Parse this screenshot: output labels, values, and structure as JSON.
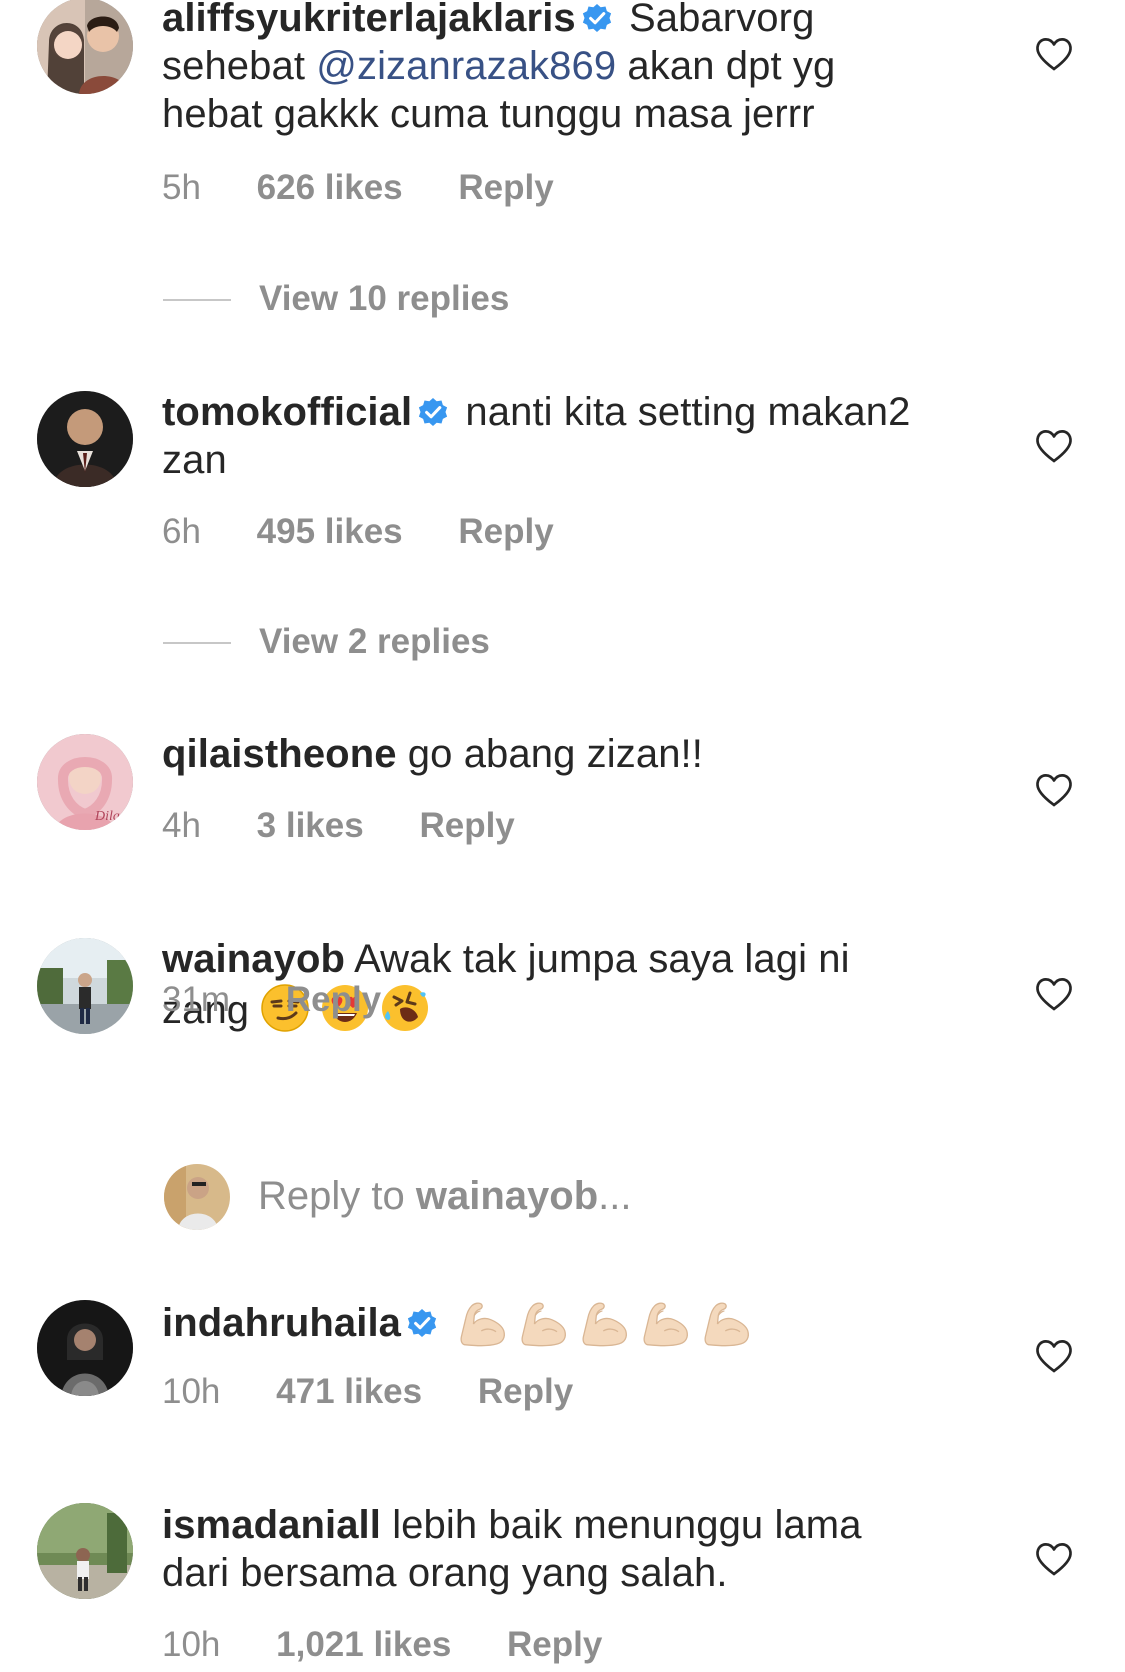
{
  "comments": [
    {
      "username": "aliffsyukriterlajaklaris",
      "verified": true,
      "text_before": " Sabarvorg sehebat ",
      "mention": "@zizanrazak869",
      "text_after": " akan dpt yg hebat gakkk cuma tunggu masa jerrr",
      "time": "5h",
      "likes": "626 likes",
      "reply_label": "Reply",
      "view_replies": "View 10 replies"
    },
    {
      "username": "tomokofficial",
      "verified": true,
      "text": " nanti kita setting makan2 zan",
      "time": "6h",
      "likes": "495 likes",
      "reply_label": "Reply",
      "view_replies": "View 2 replies"
    },
    {
      "username": "qilaistheone",
      "verified": false,
      "text": " go abang zizan!!",
      "time": "4h",
      "likes": "3 likes",
      "reply_label": "Reply"
    },
    {
      "username": "wainayob",
      "verified": false,
      "text": " Awak tak jumpa saya lagi ni zang",
      "emojis": [
        "smirking-face",
        "heart-eyes-face",
        "rolling-laughing-face"
      ],
      "time": "31m",
      "reply_label": "Reply"
    },
    {
      "username": "indahruhaila",
      "verified": true,
      "emojis": [
        "flexed-biceps",
        "flexed-biceps",
        "flexed-biceps",
        "flexed-biceps",
        "flexed-biceps"
      ],
      "time": "10h",
      "likes": "471 likes",
      "reply_label": "Reply"
    },
    {
      "username": "ismadaniall",
      "verified": false,
      "text": " lebih baik menunggu lama dari bersama orang yang salah.",
      "time": "10h",
      "likes": "1,021 likes",
      "reply_label": "Reply"
    }
  ],
  "reply_box": {
    "prefix": "Reply to ",
    "target": "wainayob",
    "suffix": "..."
  },
  "colors": {
    "text": "#262626",
    "meta": "#8e8e8e",
    "mention": "#385185",
    "verified": "#3897f0"
  },
  "icons": {
    "like": "heart-outline-icon",
    "verified": "verified-badge-icon"
  }
}
